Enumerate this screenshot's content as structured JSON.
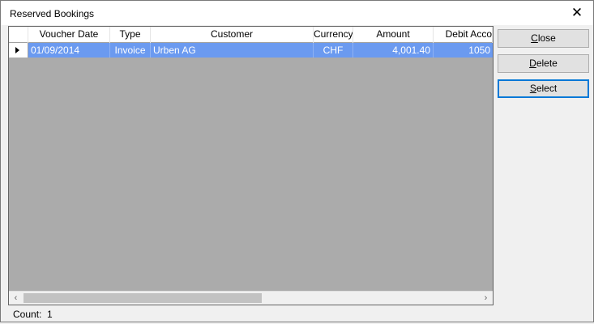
{
  "window": {
    "title": "Reserved Bookings",
    "close_glyph": "✕"
  },
  "grid": {
    "columns": [
      "Voucher Date",
      "Type",
      "Customer",
      "Currency",
      "Amount",
      "Debit Acco"
    ],
    "rows": [
      {
        "voucher_date": "01/09/2014",
        "type": "Invoice",
        "customer": "Urben AG",
        "currency": "CHF",
        "amount": "4,001.40",
        "debit_account": "1050",
        "selected": true
      }
    ],
    "selection_color": "#6b9af0",
    "scroll_left": "‹",
    "scroll_right": "›"
  },
  "buttons": {
    "close": {
      "first": "C",
      "rest": "lose"
    },
    "delete": {
      "first": "D",
      "rest": "elete"
    },
    "select": {
      "first": "S",
      "rest": "elect"
    }
  },
  "footer": {
    "count_label": "Count:",
    "count_value": "1"
  }
}
